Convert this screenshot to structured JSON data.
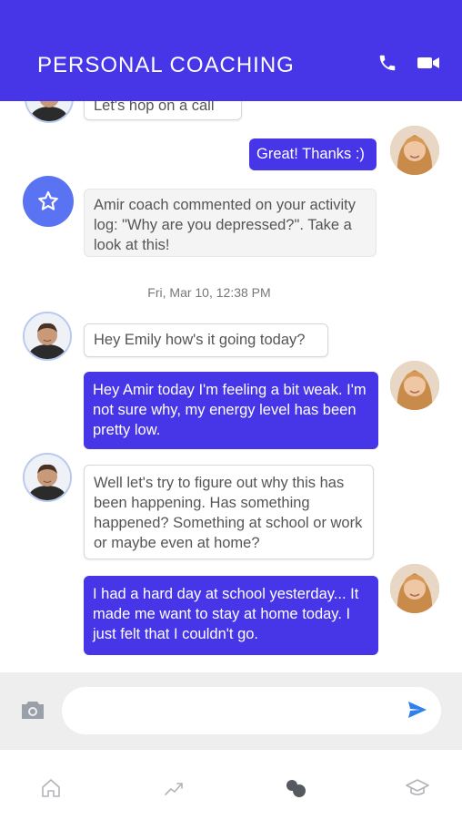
{
  "header": {
    "title": "PERSONAL COACHING",
    "call_icon": "phone-icon",
    "video_icon": "video-camera-icon"
  },
  "colors": {
    "brand": "#4735e8",
    "notice_badge": "#5a73f2",
    "send": "#2f80ed"
  },
  "messages": [
    {
      "from": "coach",
      "text": "Let's hop on a call"
    },
    {
      "from": "user",
      "text": "Great! Thanks :)"
    },
    {
      "from": "system",
      "icon": "star-icon",
      "text": "Amir coach commented on your activity log: \"Why are you depressed?\". Take a look at this!"
    },
    {
      "from": "coach",
      "text": "Hey Emily how's it going today?"
    },
    {
      "from": "user",
      "text": "Hey Amir today I'm feeling a bit weak. I'm not sure why, my energy level has been pretty low."
    },
    {
      "from": "coach",
      "text": "Well let's try to figure out why this has been happening. Has something happened? Something at school or work or maybe even at home?"
    },
    {
      "from": "user",
      "text": "I had a hard day at school yesterday... It made me want to stay at home today. I just felt that I couldn't go."
    }
  ],
  "timestamp": "Fri, Mar 10, 12:38 PM",
  "composer": {
    "placeholder": "",
    "camera_icon": "camera-icon",
    "send_icon": "send-icon"
  },
  "nav": [
    {
      "icon": "home-icon"
    },
    {
      "icon": "trend-icon"
    },
    {
      "icon": "chat-dots-icon",
      "active": true
    },
    {
      "icon": "graduation-cap-icon"
    }
  ]
}
